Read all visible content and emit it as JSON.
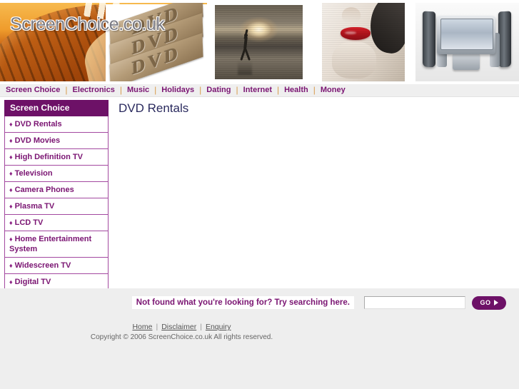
{
  "site": {
    "logo_text": "ScreenChoice.co.uk",
    "dvd_case_label": "DVD"
  },
  "topnav": {
    "items": [
      {
        "label": "Screen Choice"
      },
      {
        "label": "Electronics"
      },
      {
        "label": "Music"
      },
      {
        "label": "Holidays"
      },
      {
        "label": "Dating"
      },
      {
        "label": "Internet"
      },
      {
        "label": "Health"
      },
      {
        "label": "Money"
      }
    ],
    "separator": "|"
  },
  "sidebar": {
    "heading": "Screen Choice",
    "bullet": "♦",
    "items": [
      {
        "label": "DVD Rentals"
      },
      {
        "label": "DVD Movies"
      },
      {
        "label": "High Definition TV"
      },
      {
        "label": "Television"
      },
      {
        "label": "Camera Phones"
      },
      {
        "label": "Plasma TV"
      },
      {
        "label": "LCD TV"
      },
      {
        "label": "Home Entertainment System"
      },
      {
        "label": "Widescreen TV"
      },
      {
        "label": "Digital TV"
      }
    ]
  },
  "main": {
    "page_title": "DVD Rentals"
  },
  "search": {
    "prompt": "Not found what you're looking for? Try searching here.",
    "value": "",
    "placeholder": "",
    "go_label": "GO"
  },
  "footer": {
    "links": [
      {
        "label": "Home"
      },
      {
        "label": "Disclaimer"
      },
      {
        "label": "Enquiry"
      }
    ],
    "separator": "|",
    "copyright": "Copyright © 2006 ScreenChoice.co.uk All rights reserved."
  },
  "colors": {
    "brand_purple": "#6d1167",
    "link_purple": "#7a1472",
    "border_purple": "#a349a0",
    "title_navy": "#2a2a5e",
    "page_bg": "#eeeeee",
    "banner_orange": "#ef9c2c",
    "nav_separator": "#d79a4a"
  }
}
